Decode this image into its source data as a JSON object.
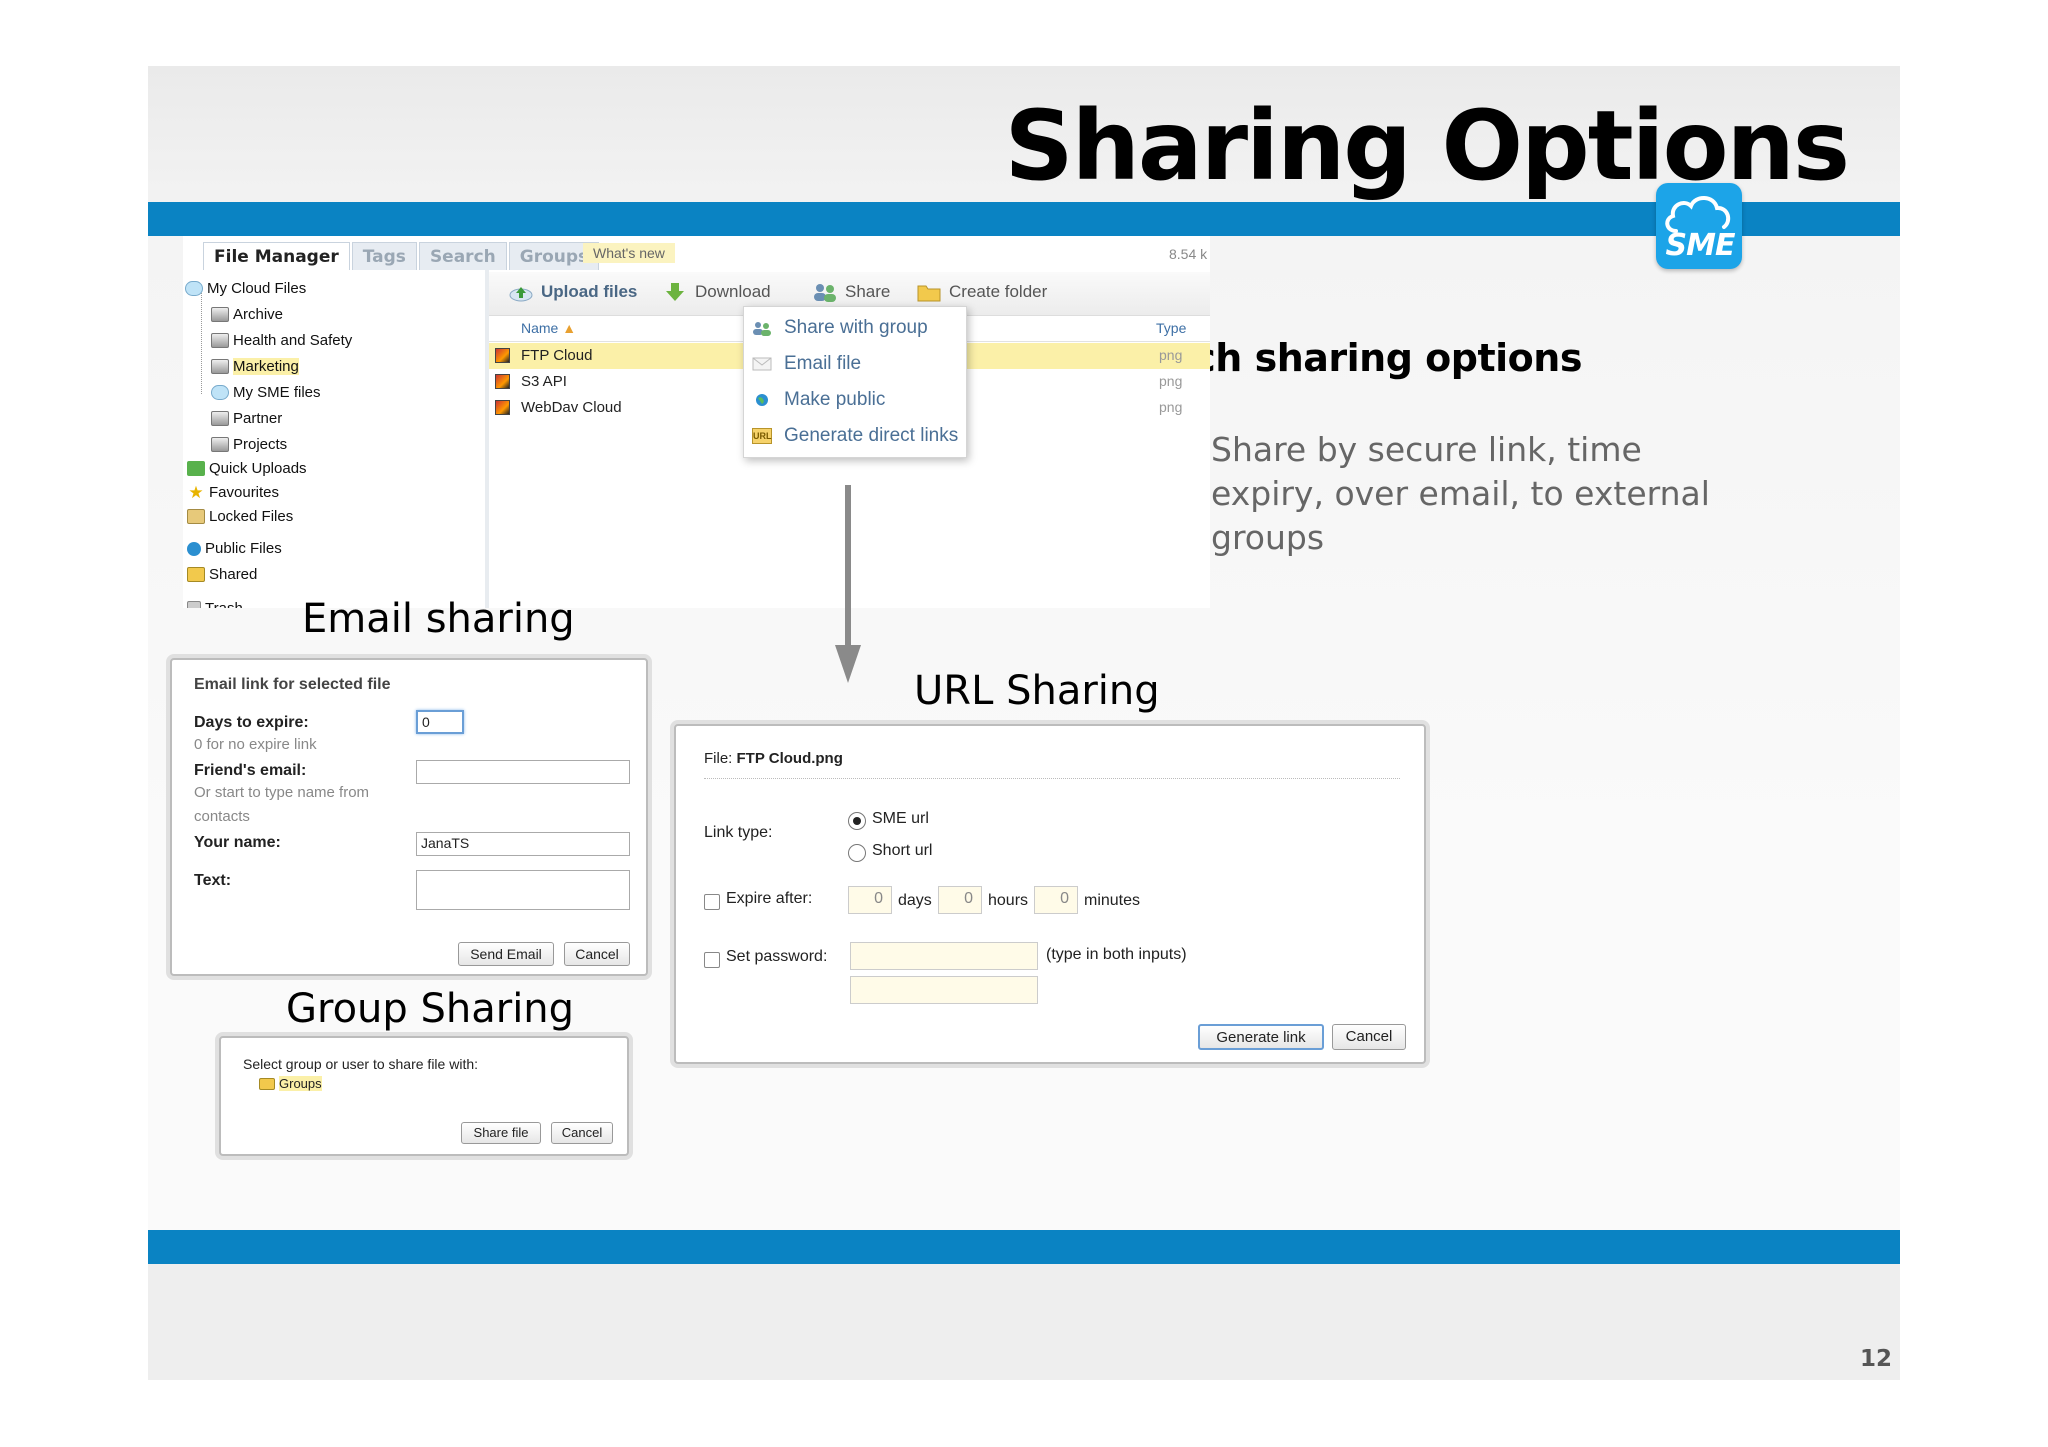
{
  "slide": {
    "title": "Sharing Options",
    "page_number": "12",
    "logo_text": "SME"
  },
  "bullets": {
    "heading": "Rich sharing options",
    "body": "Share by secure link, time expiry, over email, to external groups"
  },
  "file_manager": {
    "tabs": [
      "File Manager",
      "Tags",
      "Search",
      "Groups"
    ],
    "whats_new": "What's new",
    "storage": "8.54 k",
    "tree": {
      "my_cloud_files": "My Cloud Files",
      "archive": "Archive",
      "health_safety": "Health and Safety",
      "marketing": "Marketing",
      "my_sme_files": "My SME files",
      "partner": "Partner",
      "projects": "Projects",
      "quick_uploads": "Quick Uploads",
      "favourites": "Favourites",
      "locked_files": "Locked Files",
      "public_files": "Public Files",
      "shared": "Shared",
      "trash": "Trash"
    },
    "toolbar": {
      "upload": "Upload files",
      "download": "Download",
      "share": "Share",
      "create_folder": "Create folder"
    },
    "columns": {
      "name": "Name",
      "type": "Type"
    },
    "files": [
      {
        "name": "FTP Cloud",
        "type": "png"
      },
      {
        "name": "S3 API",
        "type": "png"
      },
      {
        "name": "WebDav Cloud",
        "type": "png"
      }
    ],
    "share_menu": {
      "share_with_group": "Share with group",
      "email_file": "Email file",
      "make_public": "Make public",
      "generate_links": "Generate direct links",
      "url_badge": "URL"
    }
  },
  "captions": {
    "email": "Email sharing",
    "url": "URL Sharing",
    "group": "Group Sharing"
  },
  "email_dialog": {
    "title": "Email link for selected file",
    "days_label": "Days to expire:",
    "days_hint": "0 for no expire link",
    "days_value": "0",
    "friend_label": "Friend's email:",
    "friend_hint_1": "Or start to type name from",
    "friend_hint_2": "contacts",
    "name_label": "Your name:",
    "name_value": "JanaTS",
    "text_label": "Text:",
    "send_button": "Send Email",
    "cancel_button": "Cancel"
  },
  "group_dialog": {
    "prompt": "Select group or user to share file with:",
    "groups": "Groups",
    "share_button": "Share file",
    "cancel_button": "Cancel"
  },
  "url_dialog": {
    "file_label": "File:",
    "file_name": "FTP Cloud.png",
    "link_type_label": "Link type:",
    "option_sme": "SME url",
    "option_short": "Short url",
    "expire_label": "Expire after:",
    "days_value": "0",
    "days_unit": "days",
    "hours_value": "0",
    "hours_unit": "hours",
    "minutes_value": "0",
    "minutes_unit": "minutes",
    "password_label": "Set password:",
    "password_hint": "(type in both inputs)",
    "generate_button": "Generate link",
    "cancel_button": "Cancel"
  },
  "colors": {
    "band_blue": "#0a83c3",
    "logo_blue": "#1ca4e8",
    "link_blue": "#4a6f95"
  }
}
